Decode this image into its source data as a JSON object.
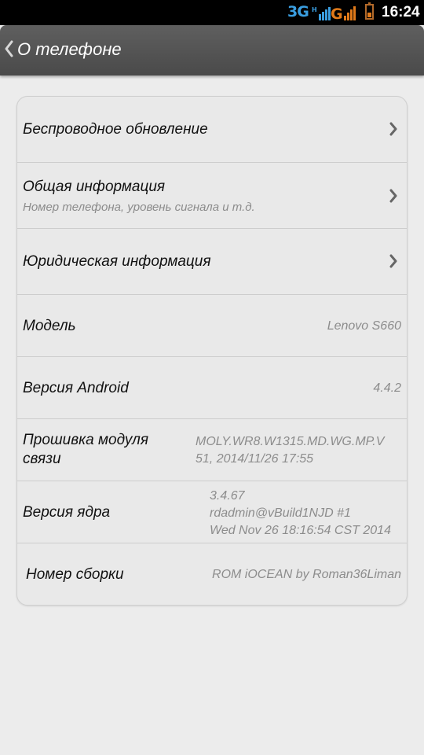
{
  "status": {
    "network": "3G",
    "time": "16:24"
  },
  "header": {
    "title": "О телефоне"
  },
  "items": {
    "update": {
      "label": "Беспроводное обновление"
    },
    "general": {
      "label": "Общая информация",
      "sub": "Номер телефона, уровень сигнала и т.д."
    },
    "legal": {
      "label": "Юридическая информация"
    },
    "model": {
      "label": "Модель",
      "value": "Lenovo S660"
    },
    "android": {
      "label": "Версия Android",
      "value": "4.4.2"
    },
    "baseband": {
      "label1": "Прошивка модуля",
      "label2": "связи",
      "value1": "MOLY.WR8.W1315.MD.WG.MP.V",
      "value2": "51, 2014/11/26 17:55"
    },
    "kernel": {
      "label": "Версия ядра",
      "value1": "3.4.67",
      "value2": "rdadmin@vBuild1NJD #1",
      "value3": "Wed Nov 26 18:16:54 CST 2014"
    },
    "build": {
      "label": "Номер сборки",
      "value": "ROM iOCEAN by Roman36Liman"
    }
  }
}
